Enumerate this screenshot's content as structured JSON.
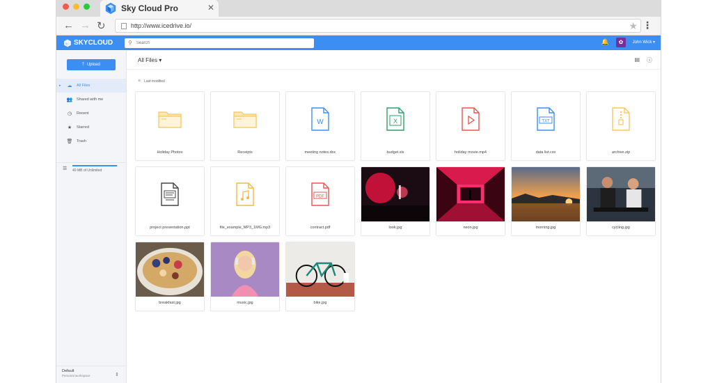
{
  "browser": {
    "tab_title": "Sky Cloud Pro",
    "tab_close": "✕",
    "url": "http://www.icedrive.io/"
  },
  "header": {
    "brand": "SKYCLOUD",
    "search_placeholder": "Search",
    "user_name": "John Wick ▾"
  },
  "sidebar": {
    "upload_label": "Upload",
    "items": [
      {
        "label": "All Files",
        "icon": "cloud-icon",
        "active": true
      },
      {
        "label": "Shared with me",
        "icon": "users-icon"
      },
      {
        "label": "Recent",
        "icon": "clock-icon"
      },
      {
        "label": "Starred",
        "icon": "star-icon"
      },
      {
        "label": "Trash",
        "icon": "trash-icon"
      }
    ],
    "storage_text": "40 MB of Unlimited",
    "storage_fraction": 0.98,
    "workspace_name": "Default",
    "workspace_sub": "Personal workspace"
  },
  "main": {
    "breadcrumb": "All Files ▾",
    "sort_label": "Last modified"
  },
  "files": [
    {
      "name": "Holiday Photos",
      "kind": "folder"
    },
    {
      "name": "Receipts",
      "kind": "folder"
    },
    {
      "name": "meeting notes.doc",
      "kind": "doc"
    },
    {
      "name": "budget.xls",
      "kind": "xls"
    },
    {
      "name": "holiday movie.mp4",
      "kind": "video"
    },
    {
      "name": "data list.csv",
      "kind": "txt"
    },
    {
      "name": "archive.zip",
      "kind": "zip"
    },
    {
      "name": "project presentation.ppt",
      "kind": "ppt"
    },
    {
      "name": "file_example_MP3_1MG.mp3",
      "kind": "audio"
    },
    {
      "name": "contract.pdf",
      "kind": "pdf"
    },
    {
      "name": "look.jpg",
      "kind": "image"
    },
    {
      "name": "neon.jpg",
      "kind": "image"
    },
    {
      "name": "morning.jpg",
      "kind": "image"
    },
    {
      "name": "cycling.jpg",
      "kind": "image"
    },
    {
      "name": "breakfast.jpg",
      "kind": "image"
    },
    {
      "name": "music.jpg",
      "kind": "image"
    },
    {
      "name": "bike.jpg",
      "kind": "image"
    }
  ],
  "colors": {
    "accent": "#3d8ef2",
    "folder": "#f6c85f",
    "doc": "#3d8ef2",
    "xls": "#2e9e6b",
    "video": "#e8554e",
    "txt": "#3d8ef2",
    "zip": "#f6c85f",
    "ppt": "#444444",
    "audio": "#f6b84a",
    "pdf": "#e8554e"
  }
}
